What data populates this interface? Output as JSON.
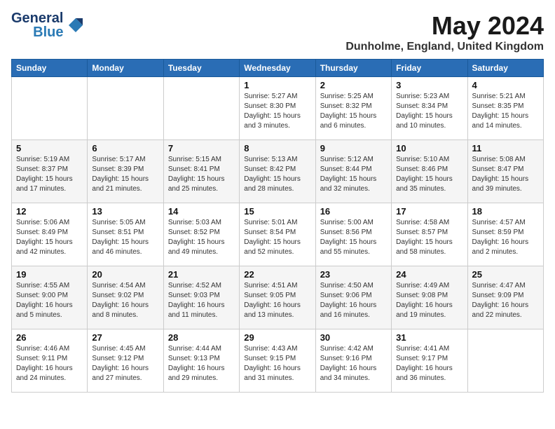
{
  "header": {
    "logo_general": "General",
    "logo_blue": "Blue",
    "title": "May 2024",
    "location": "Dunholme, England, United Kingdom"
  },
  "days_of_week": [
    "Sunday",
    "Monday",
    "Tuesday",
    "Wednesday",
    "Thursday",
    "Friday",
    "Saturday"
  ],
  "weeks": [
    [
      {
        "day": "",
        "content": ""
      },
      {
        "day": "",
        "content": ""
      },
      {
        "day": "",
        "content": ""
      },
      {
        "day": "1",
        "content": "Sunrise: 5:27 AM\nSunset: 8:30 PM\nDaylight: 15 hours\nand 3 minutes."
      },
      {
        "day": "2",
        "content": "Sunrise: 5:25 AM\nSunset: 8:32 PM\nDaylight: 15 hours\nand 6 minutes."
      },
      {
        "day": "3",
        "content": "Sunrise: 5:23 AM\nSunset: 8:34 PM\nDaylight: 15 hours\nand 10 minutes."
      },
      {
        "day": "4",
        "content": "Sunrise: 5:21 AM\nSunset: 8:35 PM\nDaylight: 15 hours\nand 14 minutes."
      }
    ],
    [
      {
        "day": "5",
        "content": "Sunrise: 5:19 AM\nSunset: 8:37 PM\nDaylight: 15 hours\nand 17 minutes."
      },
      {
        "day": "6",
        "content": "Sunrise: 5:17 AM\nSunset: 8:39 PM\nDaylight: 15 hours\nand 21 minutes."
      },
      {
        "day": "7",
        "content": "Sunrise: 5:15 AM\nSunset: 8:41 PM\nDaylight: 15 hours\nand 25 minutes."
      },
      {
        "day": "8",
        "content": "Sunrise: 5:13 AM\nSunset: 8:42 PM\nDaylight: 15 hours\nand 28 minutes."
      },
      {
        "day": "9",
        "content": "Sunrise: 5:12 AM\nSunset: 8:44 PM\nDaylight: 15 hours\nand 32 minutes."
      },
      {
        "day": "10",
        "content": "Sunrise: 5:10 AM\nSunset: 8:46 PM\nDaylight: 15 hours\nand 35 minutes."
      },
      {
        "day": "11",
        "content": "Sunrise: 5:08 AM\nSunset: 8:47 PM\nDaylight: 15 hours\nand 39 minutes."
      }
    ],
    [
      {
        "day": "12",
        "content": "Sunrise: 5:06 AM\nSunset: 8:49 PM\nDaylight: 15 hours\nand 42 minutes."
      },
      {
        "day": "13",
        "content": "Sunrise: 5:05 AM\nSunset: 8:51 PM\nDaylight: 15 hours\nand 46 minutes."
      },
      {
        "day": "14",
        "content": "Sunrise: 5:03 AM\nSunset: 8:52 PM\nDaylight: 15 hours\nand 49 minutes."
      },
      {
        "day": "15",
        "content": "Sunrise: 5:01 AM\nSunset: 8:54 PM\nDaylight: 15 hours\nand 52 minutes."
      },
      {
        "day": "16",
        "content": "Sunrise: 5:00 AM\nSunset: 8:56 PM\nDaylight: 15 hours\nand 55 minutes."
      },
      {
        "day": "17",
        "content": "Sunrise: 4:58 AM\nSunset: 8:57 PM\nDaylight: 15 hours\nand 58 minutes."
      },
      {
        "day": "18",
        "content": "Sunrise: 4:57 AM\nSunset: 8:59 PM\nDaylight: 16 hours\nand 2 minutes."
      }
    ],
    [
      {
        "day": "19",
        "content": "Sunrise: 4:55 AM\nSunset: 9:00 PM\nDaylight: 16 hours\nand 5 minutes."
      },
      {
        "day": "20",
        "content": "Sunrise: 4:54 AM\nSunset: 9:02 PM\nDaylight: 16 hours\nand 8 minutes."
      },
      {
        "day": "21",
        "content": "Sunrise: 4:52 AM\nSunset: 9:03 PM\nDaylight: 16 hours\nand 11 minutes."
      },
      {
        "day": "22",
        "content": "Sunrise: 4:51 AM\nSunset: 9:05 PM\nDaylight: 16 hours\nand 13 minutes."
      },
      {
        "day": "23",
        "content": "Sunrise: 4:50 AM\nSunset: 9:06 PM\nDaylight: 16 hours\nand 16 minutes."
      },
      {
        "day": "24",
        "content": "Sunrise: 4:49 AM\nSunset: 9:08 PM\nDaylight: 16 hours\nand 19 minutes."
      },
      {
        "day": "25",
        "content": "Sunrise: 4:47 AM\nSunset: 9:09 PM\nDaylight: 16 hours\nand 22 minutes."
      }
    ],
    [
      {
        "day": "26",
        "content": "Sunrise: 4:46 AM\nSunset: 9:11 PM\nDaylight: 16 hours\nand 24 minutes."
      },
      {
        "day": "27",
        "content": "Sunrise: 4:45 AM\nSunset: 9:12 PM\nDaylight: 16 hours\nand 27 minutes."
      },
      {
        "day": "28",
        "content": "Sunrise: 4:44 AM\nSunset: 9:13 PM\nDaylight: 16 hours\nand 29 minutes."
      },
      {
        "day": "29",
        "content": "Sunrise: 4:43 AM\nSunset: 9:15 PM\nDaylight: 16 hours\nand 31 minutes."
      },
      {
        "day": "30",
        "content": "Sunrise: 4:42 AM\nSunset: 9:16 PM\nDaylight: 16 hours\nand 34 minutes."
      },
      {
        "day": "31",
        "content": "Sunrise: 4:41 AM\nSunset: 9:17 PM\nDaylight: 16 hours\nand 36 minutes."
      },
      {
        "day": "",
        "content": ""
      }
    ]
  ]
}
